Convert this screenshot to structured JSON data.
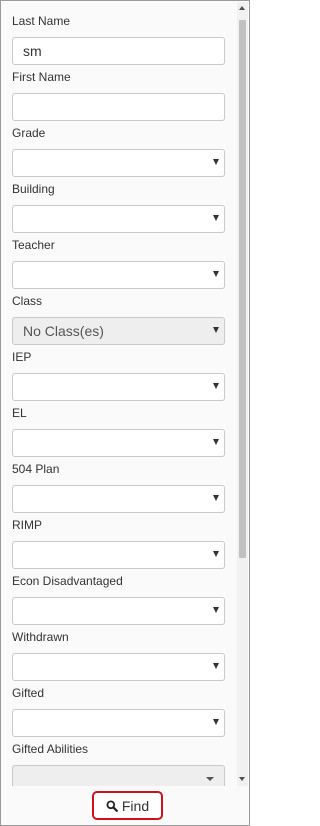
{
  "fields": {
    "last_name": {
      "label": "Last Name",
      "value": "sm"
    },
    "first_name": {
      "label": "First Name",
      "value": ""
    },
    "grade": {
      "label": "Grade",
      "value": ""
    },
    "building": {
      "label": "Building",
      "value": ""
    },
    "teacher": {
      "label": "Teacher",
      "value": ""
    },
    "class": {
      "label": "Class",
      "value": "No Class(es)"
    },
    "iep": {
      "label": "IEP",
      "value": ""
    },
    "el": {
      "label": "EL",
      "value": ""
    },
    "plan504": {
      "label": "504 Plan",
      "value": ""
    },
    "rimp": {
      "label": "RIMP",
      "value": ""
    },
    "econ": {
      "label": "Econ Disadvantaged",
      "value": ""
    },
    "withdrawn": {
      "label": "Withdrawn",
      "value": ""
    },
    "gifted": {
      "label": "Gifted",
      "value": ""
    },
    "gifted_abilities": {
      "label": "Gifted Abilities",
      "value": ""
    }
  },
  "find_button": {
    "label": "Find",
    "icon": "search-icon",
    "highlight_color": "#d0101c"
  }
}
